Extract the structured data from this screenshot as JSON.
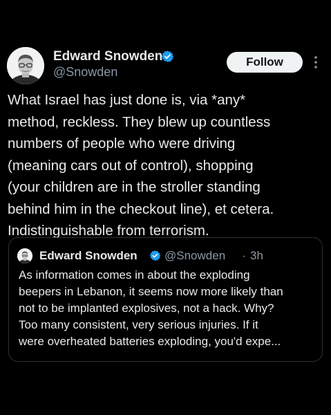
{
  "author": {
    "display_name": "Edward Snowden",
    "handle": "@Snowden",
    "verified_icon": "verified-badge-icon",
    "avatar_icon": "avatar-portrait"
  },
  "actions": {
    "follow_label": "Follow",
    "more_icon": "more-vertical-icon"
  },
  "post": {
    "text": "What Israel has just done is, via *any*\nmethod, reckless. They blew up countless\nnumbers of people who were driving\n(meaning cars out of control), shopping\n(your children are in the stroller standing\nbehind him in the checkout line), et cetera.\nIndistinguishable from terrorism."
  },
  "quote": {
    "display_name": "Edward Snowden",
    "handle": "@Snowden",
    "separator": "·",
    "time": "3h",
    "text": "As information comes in about the exploding\nbeepers in Lebanon, it seems now more likely than\nnot to be implanted explosives, not a hack. Why?\nToo many consistent, very serious injuries. If it\nwere overheated batteries exploding, you'd expe..."
  },
  "colors": {
    "background": "#000000",
    "text_primary": "#e7e9ea",
    "text_secondary": "#8b98a5",
    "verified_blue": "#1d9bf0",
    "follow_button_bg": "#eff3f4",
    "border": "#2f3336"
  }
}
